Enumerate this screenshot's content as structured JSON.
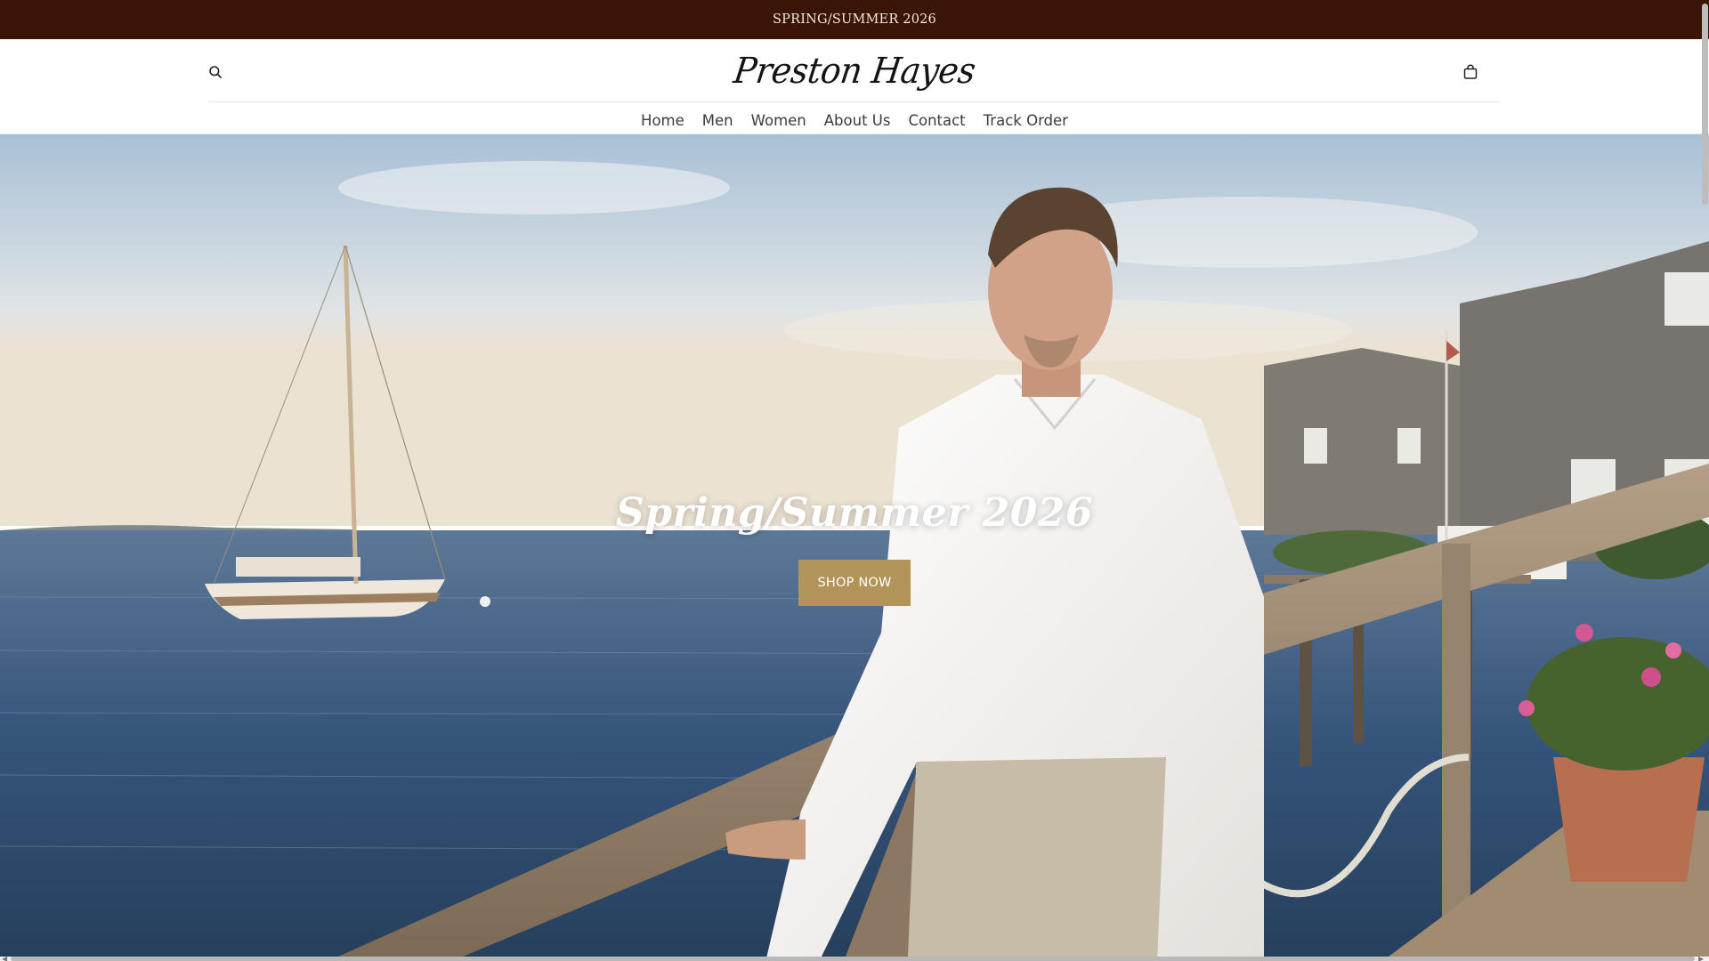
{
  "announcement": {
    "text": "SPRING/SUMMER 2026"
  },
  "header": {
    "logo": "Preston Hayes",
    "icons": {
      "search": "search-icon",
      "cart": "shopping-bag-icon"
    },
    "nav": [
      {
        "label": "Home"
      },
      {
        "label": "Men"
      },
      {
        "label": "Women"
      },
      {
        "label": "About Us"
      },
      {
        "label": "Contact"
      },
      {
        "label": "Track Order"
      }
    ]
  },
  "hero": {
    "title": "Spring/Summer 2026",
    "cta_label": "SHOP NOW",
    "image_icon": "hero-image"
  },
  "colors": {
    "announcement_bg": "#3a1506",
    "cta_bg": "#b39458",
    "nav_text": "#3b3b3b"
  }
}
